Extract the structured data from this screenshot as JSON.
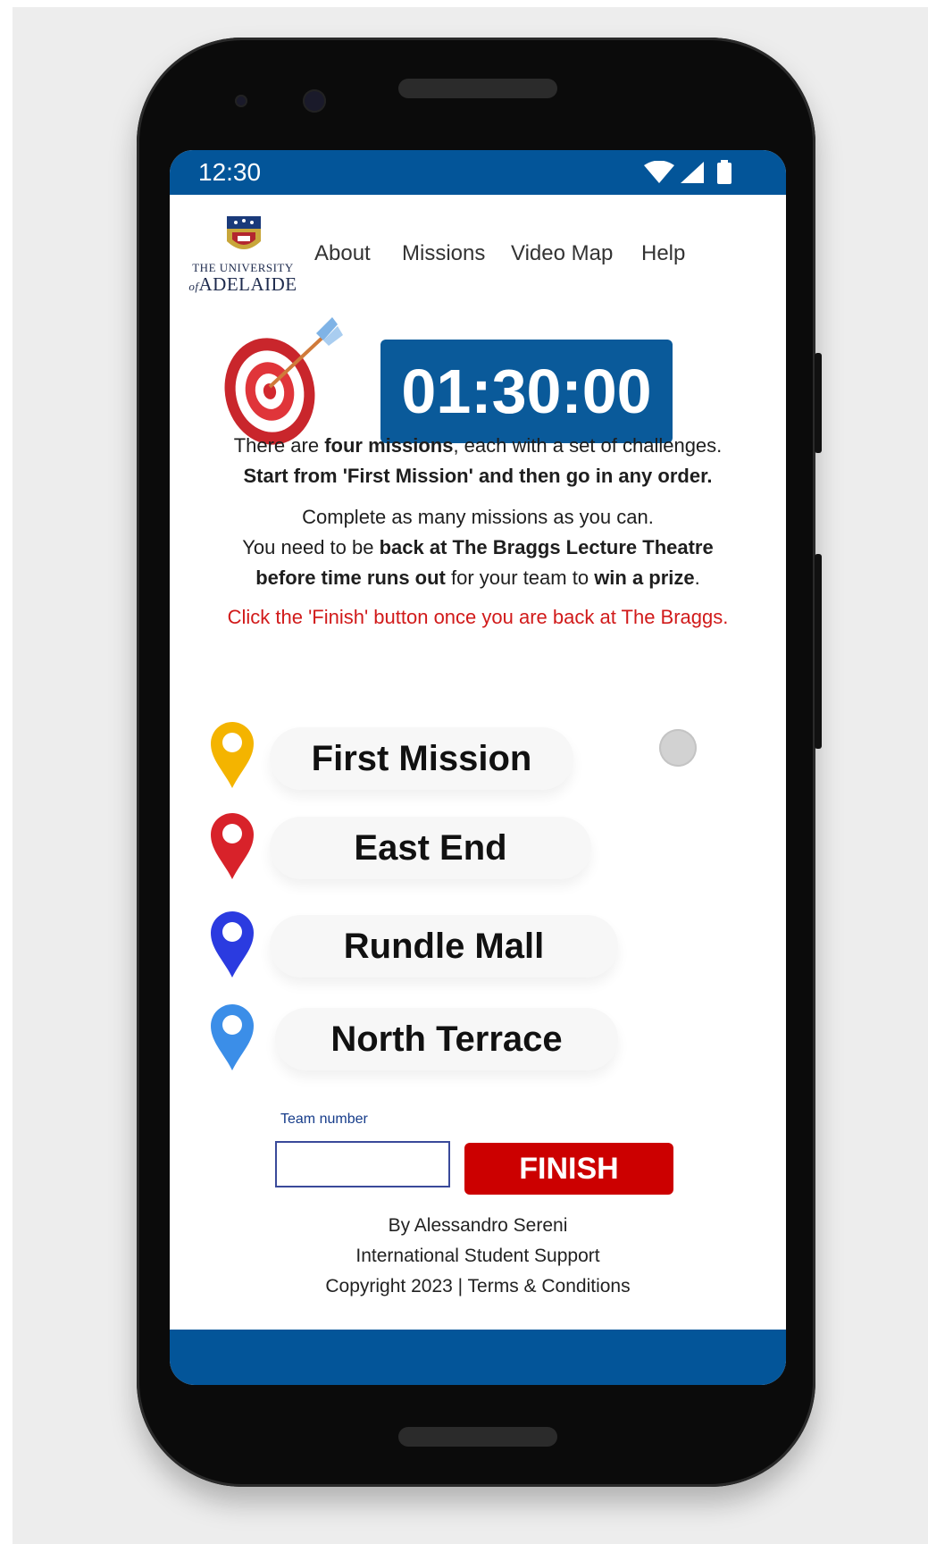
{
  "status_bar": {
    "time": "12:30"
  },
  "logo": {
    "line1": "THE UNIVERSITY",
    "line2": "ADELAIDE",
    "prefix": "of"
  },
  "nav": {
    "items": [
      "About",
      "Missions",
      "Video Map",
      "Help"
    ]
  },
  "timer": {
    "value": "01:30:00"
  },
  "intro": {
    "line1_pre": "There are ",
    "line1_bold": "four missions",
    "line1_post": ", each with a set of challenges.",
    "line2_bold": "Start from 'First Mission' and then go in any order.",
    "line3": "Complete as many missions as you can.",
    "line4_pre": "You need to be ",
    "line4_bold": "back at The Braggs Lecture Theatre",
    "line5_bold1": "before time runs out",
    "line5_mid": " for your team to ",
    "line5_bold2": "win a prize",
    "line5_post": ".",
    "notice": "Click the 'Finish' button once you are back at The Braggs."
  },
  "missions": [
    {
      "label": "First Mission",
      "pin_color": "#f4b400",
      "pin_icon": "map-pin-yellow"
    },
    {
      "label": "East End",
      "pin_color": "#d8222a",
      "pin_icon": "map-pin-red"
    },
    {
      "label": "Rundle Mall",
      "pin_color": "#2b3be0",
      "pin_icon": "map-pin-blue"
    },
    {
      "label": "North Terrace",
      "pin_color": "#3b8ee8",
      "pin_icon": "map-pin-light-blue"
    }
  ],
  "team": {
    "label": "Team number",
    "value": ""
  },
  "finish_label": "FINISH",
  "footer": {
    "line1": "By Alessandro Sereni",
    "line2": "International Student Support",
    "line3": "Copyright 2023 | Terms & Conditions"
  },
  "colors": {
    "brand_blue": "#035599",
    "finish_red": "#cc0000",
    "notice_red": "#d11a1a"
  }
}
